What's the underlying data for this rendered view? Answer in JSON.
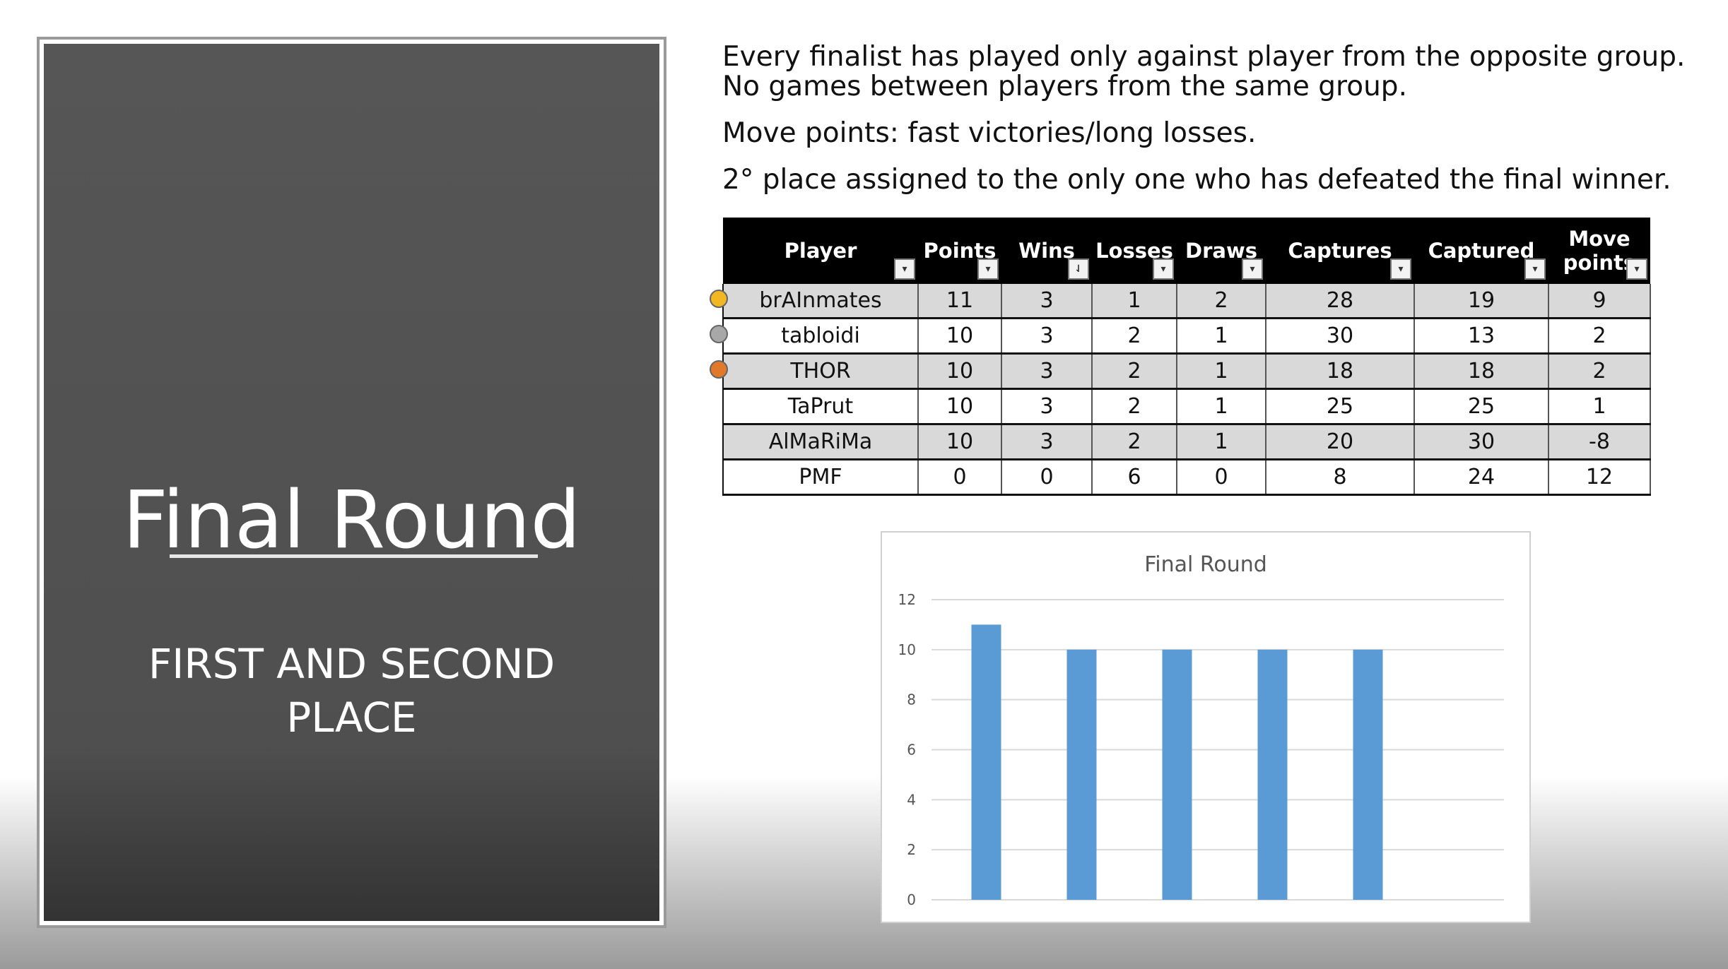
{
  "slide": {
    "title": "Final Round",
    "subtitle_line1": "FIRST AND SECOND",
    "subtitle_line2": "PLACE"
  },
  "notes": {
    "line1": "Every finalist has played only against player from the opposite group.",
    "line2": "No games between players from the same group.",
    "line3": "Move points: fast victories/long losses.",
    "line4": "2° place assigned to the only one who has defeated the final winner."
  },
  "table": {
    "headers": [
      "Player",
      "Points",
      "Wins",
      "Losses",
      "Draws",
      "Captures",
      "Captured",
      "Move points"
    ],
    "rows": [
      [
        "brAInmates",
        "11",
        "3",
        "1",
        "2",
        "28",
        "19",
        "9"
      ],
      [
        "tabloidi",
        "10",
        "3",
        "2",
        "1",
        "30",
        "13",
        "2"
      ],
      [
        "THOR",
        "10",
        "3",
        "2",
        "1",
        "18",
        "18",
        "2"
      ],
      [
        "TaPrut",
        "10",
        "3",
        "2",
        "1",
        "25",
        "25",
        "1"
      ],
      [
        "AlMaRiMa",
        "10",
        "3",
        "2",
        "1",
        "20",
        "30",
        "-8"
      ],
      [
        "PMF",
        "0",
        "0",
        "6",
        "0",
        "8",
        "24",
        "12"
      ]
    ],
    "medal_colors": [
      "#f2b824",
      "#a8a8a8",
      "#e0792a"
    ]
  },
  "chart_data": {
    "type": "bar",
    "title": "Final Round",
    "categories": [
      "",
      "",
      "",
      "",
      ""
    ],
    "values": [
      11,
      10,
      10,
      10,
      10
    ],
    "ylim": [
      0,
      12
    ],
    "yticks": [
      0,
      2,
      4,
      6,
      8,
      10,
      12
    ],
    "bar_color": "#5b9bd5",
    "grid": true
  }
}
